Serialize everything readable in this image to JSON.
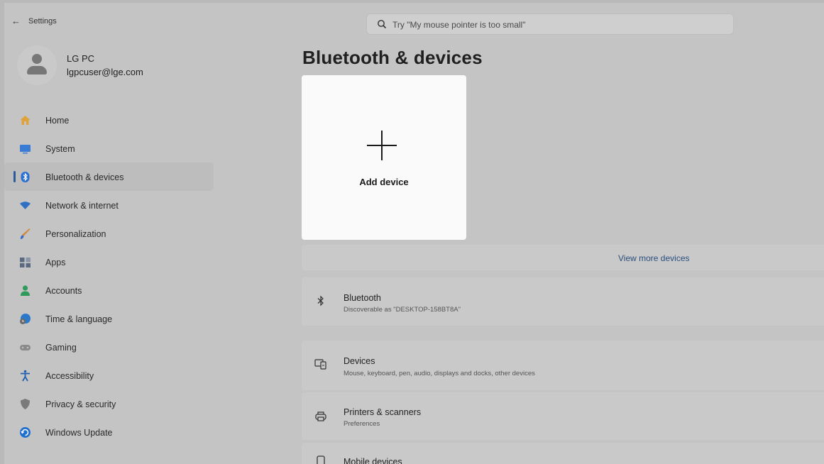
{
  "window": {
    "back_icon": "arrow-left-icon",
    "title": "Settings"
  },
  "search": {
    "placeholder": "Try \"My mouse pointer is too small\"",
    "icon": "search-icon"
  },
  "profile": {
    "name": "LG PC",
    "email": "lgpcuser@lge.com"
  },
  "sidebar": {
    "selected_index": 2,
    "items": [
      {
        "label": "Home",
        "icon": "home-icon",
        "color": "#e0a23a"
      },
      {
        "label": "System",
        "icon": "monitor-icon",
        "color": "#3a7bd5"
      },
      {
        "label": "Bluetooth & devices",
        "icon": "bluetooth-icon",
        "color": "#2a6fd6"
      },
      {
        "label": "Network & internet",
        "icon": "wifi-icon",
        "color": "#2f6fc4"
      },
      {
        "label": "Personalization",
        "icon": "brush-icon",
        "color": "#d08a3a"
      },
      {
        "label": "Apps",
        "icon": "apps-icon",
        "color": "#5a6a80"
      },
      {
        "label": "Accounts",
        "icon": "person-icon",
        "color": "#2f9a5a"
      },
      {
        "label": "Time & language",
        "icon": "globe-clock-icon",
        "color": "#2a78c8"
      },
      {
        "label": "Gaming",
        "icon": "gamepad-icon",
        "color": "#8a8a8a"
      },
      {
        "label": "Accessibility",
        "icon": "accessibility-icon",
        "color": "#1e5fb0"
      },
      {
        "label": "Privacy & security",
        "icon": "shield-icon",
        "color": "#7a7a7a"
      },
      {
        "label": "Windows Update",
        "icon": "update-icon",
        "color": "#1f6fd0"
      }
    ]
  },
  "main": {
    "title": "Bluetooth & devices",
    "add_device": {
      "label": "Add device",
      "icon": "plus-icon"
    },
    "view_more": "View more devices",
    "bluetooth": {
      "icon": "bluetooth-icon",
      "title": "Bluetooth",
      "subtitle": "Discoverable as \"DESKTOP-158BT8A\""
    },
    "devices": {
      "icon": "devices-icon",
      "title": "Devices",
      "subtitle": "Mouse, keyboard, pen, audio, displays and docks, other devices"
    },
    "printers": {
      "icon": "printer-icon",
      "title": "Printers & scanners",
      "subtitle": "Preferences"
    },
    "mobile": {
      "icon": "phone-icon",
      "title": "Mobile devices"
    }
  },
  "colors": {
    "accent": "#2a5c99",
    "link": "#2a4f7e"
  }
}
